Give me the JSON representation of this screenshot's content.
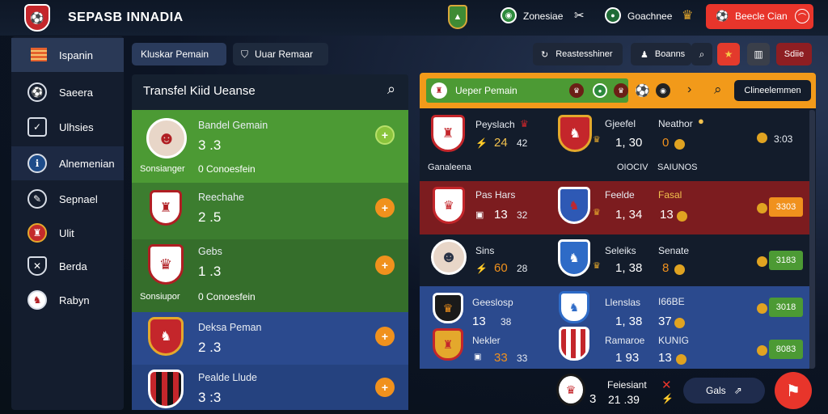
{
  "app": {
    "title": "SEPASB INNADIA"
  },
  "topbar": {
    "item1": "Zonesiae",
    "item2": "Goachnee",
    "cta": "Beecle Cian"
  },
  "sidebar": {
    "items": [
      {
        "label": "Ispanin",
        "icon": "flag-icon"
      },
      {
        "label": "Saeera",
        "icon": "ball-icon"
      },
      {
        "label": "Ulhsies",
        "icon": "check-icon"
      },
      {
        "label": "Alnemenian",
        "icon": "info-icon"
      },
      {
        "label": "Sepnael",
        "icon": "edit-icon"
      },
      {
        "label": "Ulit",
        "icon": "crest-icon"
      },
      {
        "label": "Berda",
        "icon": "shield-icon"
      },
      {
        "label": "Rabyn",
        "icon": "club-icon"
      }
    ]
  },
  "tabs": {
    "tab1": "Kluskar Pemain",
    "tab2": "Uuar Remaar"
  },
  "toolbar": {
    "btn1": "Reastesshiner",
    "btn2": "Boanns",
    "btn3": "Sdiie"
  },
  "transfer": {
    "title": "Transfel Kiid Ueanse",
    "cards": [
      {
        "name": "Bandel Gemain",
        "score": "3 .3",
        "left": "Sonsianger",
        "right": "0  Conoesfein"
      },
      {
        "name": "Reechahe",
        "score": "2 .5"
      },
      {
        "name": "Gebs",
        "score": "1 .3",
        "left": "Sonsiupor",
        "right": "0  Conoesfein"
      },
      {
        "name": "Deksa Peman",
        "score": "2 .3"
      },
      {
        "name": "Pealde Llude",
        "score": "3 :3"
      }
    ]
  },
  "match": {
    "header": "Ueper Pemain",
    "header_button": "Clineelemmen",
    "rows": [
      {
        "n1": "Peyslach",
        "s1": "24",
        "v1": "42",
        "n2": "Gjeefel",
        "s2": "1, 30",
        "n3": "Neathor",
        "s3": "0",
        "score": "3:03"
      },
      {
        "n1": "Pas Hars",
        "s1": "13",
        "v1": "32",
        "n2": "Feelde",
        "s2": "1, 34",
        "n3": "Fasal",
        "s3": "13",
        "score": "3303"
      },
      {
        "n1": "Sins",
        "s1": "60",
        "v1": "28",
        "n2": "Seleiks",
        "s2": "1, 38",
        "n3": "Senate",
        "s3": "8",
        "score": "3183"
      },
      {
        "n1": "Geeslosp",
        "s1": "13",
        "v1": "38",
        "n2": "Llenslas",
        "s2": "1, 38",
        "n3": "I66BE",
        "s3": "37",
        "score": "3018"
      },
      {
        "n1": "Nekler",
        "s1": "33",
        "v1": "33",
        "n2": "Ramaroe",
        "s2": "1 93",
        "n3": "KUNIG",
        "s3": "13",
        "score": "8083"
      }
    ],
    "sub": {
      "left": "Ganaleena",
      "right1": "OIOCIV",
      "right2": "SAIUNOS"
    }
  },
  "footer": {
    "label": "Feiesiant",
    "value": "21 .39",
    "count": "3",
    "btn": "Gals"
  },
  "colors": {
    "accent_orange": "#f29a1a",
    "green": "#4c9a34",
    "red_row": "#7c1c1f",
    "blue_row": "#2b4a8e",
    "cta_red": "#e8352b"
  }
}
